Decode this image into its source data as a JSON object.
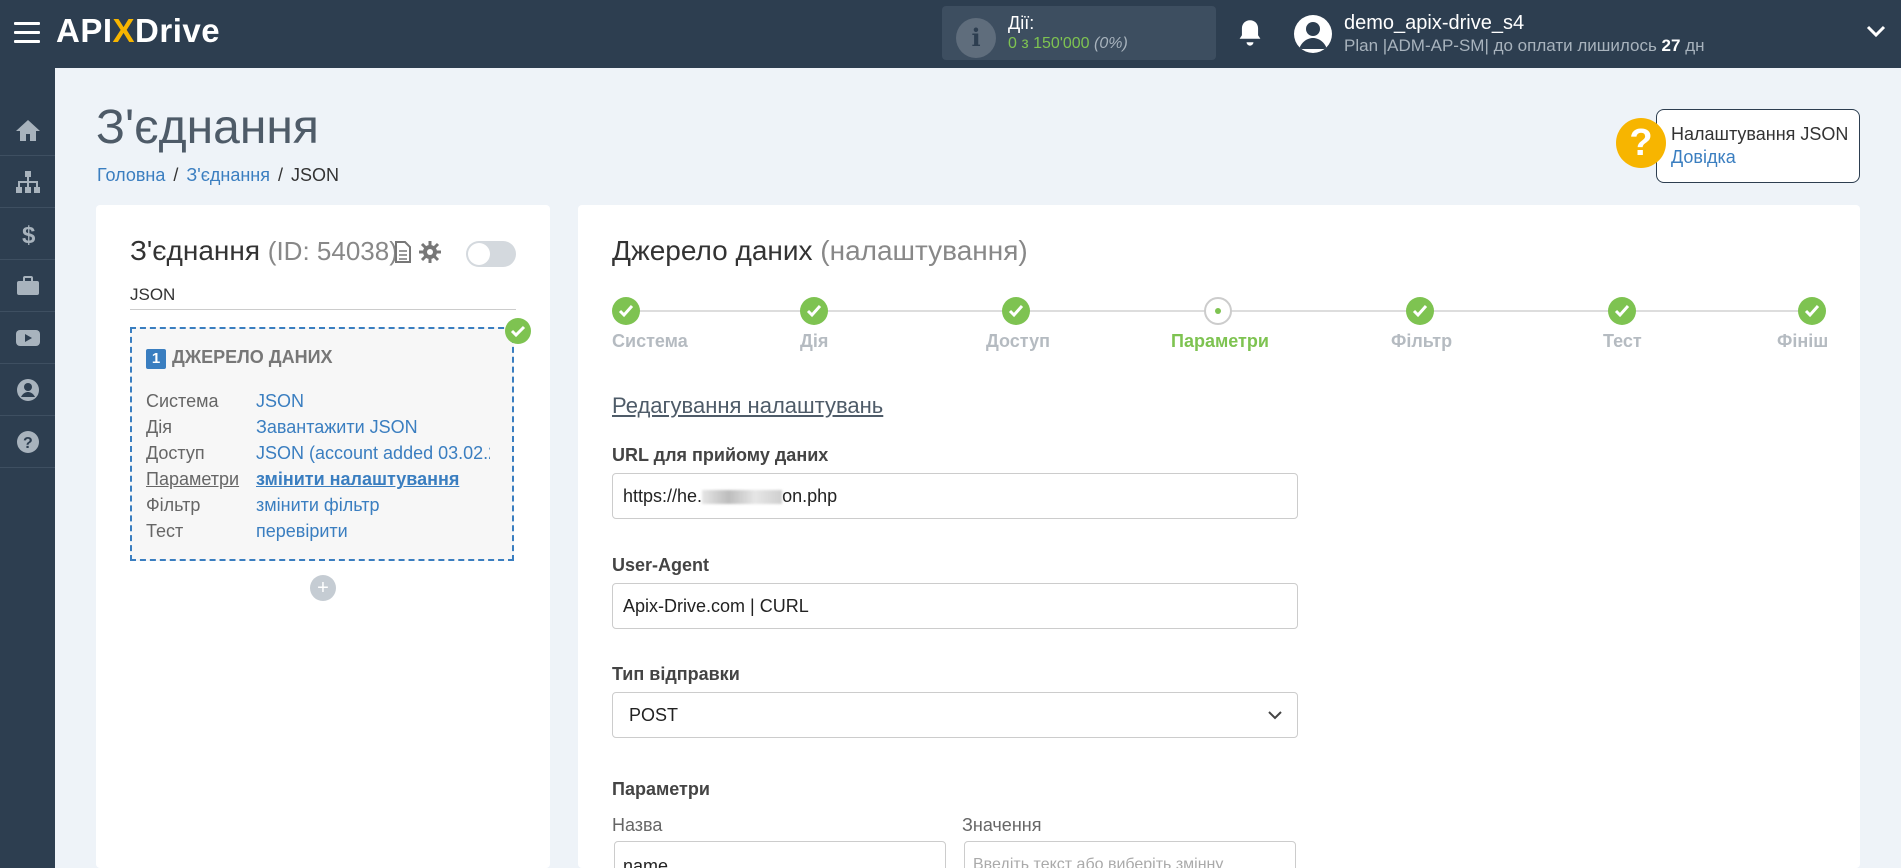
{
  "topbar": {
    "logo_left": "API",
    "logo_x": "X",
    "logo_right": "Drive",
    "actions_label": "Дії:",
    "actions_count": "0 з 150'000",
    "actions_percent": "(0%)",
    "user_name": "demo_apix-drive_s4",
    "plan_prefix": "Plan |ADM-AP-SM| до оплати лишилось ",
    "plan_days": "27",
    "plan_suffix": " дн"
  },
  "sidebar": {
    "items": [
      "home-icon",
      "sitemap-icon",
      "dollar-icon",
      "briefcase-icon",
      "youtube-icon",
      "user-icon",
      "help-icon"
    ]
  },
  "page": {
    "title": "З'єднання",
    "breadcrumb": [
      "Головна",
      "З'єднання",
      "JSON"
    ]
  },
  "help": {
    "mark": "?",
    "title": "Налаштування JSON",
    "link": "Довідка"
  },
  "left_card": {
    "title": "З'єднання",
    "id_text": "(ID: 54038)",
    "name": "JSON",
    "source_number": "1",
    "source_header": "ДЖЕРЕЛО ДАНИХ",
    "rows": [
      {
        "key": "Система",
        "value": "JSON"
      },
      {
        "key": "Дія",
        "value": "Завантажити JSON"
      },
      {
        "key": "Доступ",
        "value": "JSON (account added 03.02.2"
      },
      {
        "key": "Параметри",
        "value": "змінити налаштування"
      },
      {
        "key": "Фільтр",
        "value": "змінити фільтр"
      },
      {
        "key": "Тест",
        "value": "перевірити"
      }
    ],
    "add_symbol": "+"
  },
  "right_card": {
    "title": "Джерело даних",
    "title_suffix": "(налаштування)",
    "steps": [
      "Система",
      "Дія",
      "Доступ",
      "Параметри",
      "Фільтр",
      "Тест",
      "Фініш"
    ],
    "current_step": "Параметри",
    "section_title": "Редагування налаштувань",
    "url_label": "URL для прийому даних",
    "url_value_start": "https://he.",
    "url_value_end": "on.php",
    "ua_label": "User-Agent",
    "ua_value": "Apix-Drive.com | CURL",
    "type_label": "Тип відправки",
    "type_value": "POST",
    "params_label": "Параметри",
    "param_name_label": "Назва",
    "param_value_label": "Значення",
    "param_name_value": "name",
    "param_value_placeholder": "Введіть текст або виберіть змінну"
  },
  "colors": {
    "topbar": "#2d3e50",
    "accent_green": "#7ec351",
    "link_blue": "#3a7ec0",
    "help_yellow": "#f7b500"
  }
}
